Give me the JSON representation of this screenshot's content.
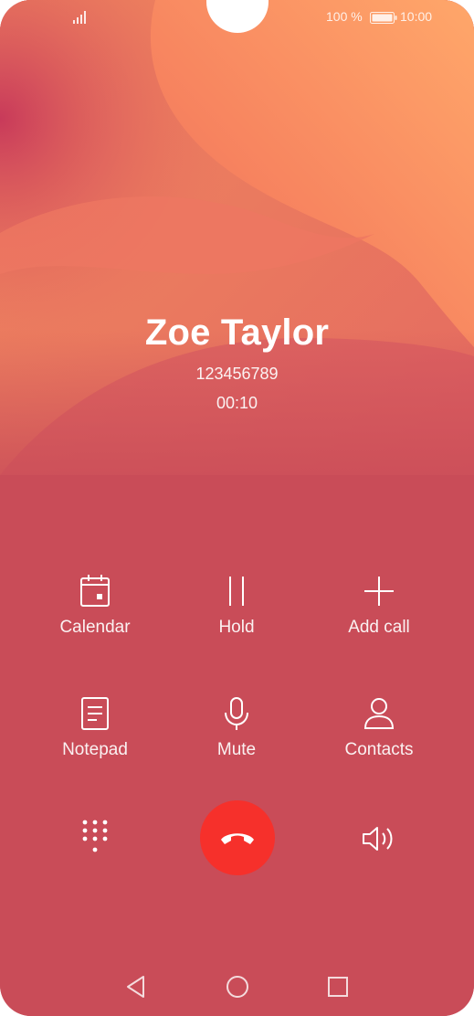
{
  "status_bar": {
    "signal_icon": "signal-bars-icon",
    "battery_percent": "100 %",
    "battery_icon": "battery-icon",
    "time": "10:00"
  },
  "call": {
    "contact_name": "Zoe Taylor",
    "number": "123456789",
    "duration": "00:10"
  },
  "actions": {
    "calendar": {
      "label": "Calendar",
      "icon": "calendar-icon"
    },
    "hold": {
      "label": "Hold",
      "icon": "pause-icon"
    },
    "add_call": {
      "label": "Add call",
      "icon": "plus-icon"
    },
    "notepad": {
      "label": "Notepad",
      "icon": "notepad-icon"
    },
    "mute": {
      "label": "Mute",
      "icon": "microphone-icon"
    },
    "contacts": {
      "label": "Contacts",
      "icon": "person-icon"
    }
  },
  "controls": {
    "dialpad_icon": "dialpad-icon",
    "end_call_icon": "hang-up-icon",
    "speaker_icon": "speaker-icon"
  },
  "nav_bar": {
    "back_icon": "back-triangle-icon",
    "home_icon": "home-circle-icon",
    "recents_icon": "recents-square-icon"
  },
  "colors": {
    "background": "#c94c58",
    "end_call": "#f6302b",
    "gradient_top": "#ffa46a"
  }
}
